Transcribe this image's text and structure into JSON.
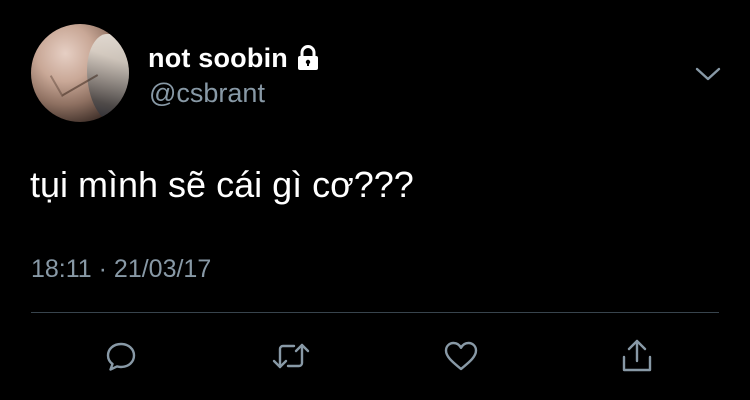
{
  "tweet": {
    "display_name": "not soobin",
    "handle": "@csbrant",
    "text": "tụi mình sẽ cái gì cơ???",
    "timestamp": "18:11 · 21/03/17",
    "protected_icon": "lock-icon",
    "menu_icon": "chevron-down-icon"
  },
  "actions": [
    {
      "name": "reply",
      "icon": "reply-icon"
    },
    {
      "name": "retweet",
      "icon": "retweet-icon"
    },
    {
      "name": "like",
      "icon": "heart-icon"
    },
    {
      "name": "share",
      "icon": "share-icon"
    }
  ],
  "colors": {
    "background": "#000000",
    "primary_text": "#ffffff",
    "secondary_text": "#8899a6",
    "icon": "#8899a6",
    "divider": "#38444d"
  }
}
